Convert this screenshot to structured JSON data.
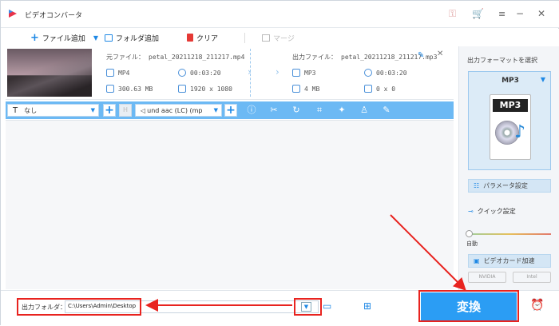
{
  "app": {
    "title": "ビデオコンバータ"
  },
  "toolbar": {
    "add_file": "ファイル追加",
    "add_folder": "フォルダ追加",
    "clear": "クリア",
    "merge": "マージ"
  },
  "file": {
    "source_label": "元ファイル：",
    "source_name": "petal_20211218_211217.mp4",
    "output_label": "出力ファイル：",
    "output_name": "petal_20211218_211217.mp3",
    "src_format": "MP4",
    "src_duration": "00:03:20",
    "src_size": "300.63 MB",
    "src_resolution": "1920 x 1080",
    "out_format": "MP3",
    "out_duration": "00:03:20",
    "out_size": "4 MB",
    "out_resolution": "0 x 0"
  },
  "editbar": {
    "subtitle": "なし",
    "audio": "und aac (LC) (mp"
  },
  "right": {
    "format_header": "出力フォーマットを選択",
    "format_value": "MP3",
    "format_icon_text": "MP3",
    "params_button": "パラメータ設定",
    "quick_label": "クイック設定",
    "auto_label": "自動",
    "gpu_label": "ビデオカード加速",
    "nvidia": "NVIDIA",
    "intel": "Intel"
  },
  "bottom": {
    "folder_label": "出力フォルダ：",
    "folder_path": "C:\\Users\\Admin\\Desktop",
    "convert": "変換"
  },
  "colors": {
    "accent": "#1e88e5",
    "bar": "#6cb9f4",
    "convert": "#2b9df4",
    "highlight": "#e8231f"
  }
}
